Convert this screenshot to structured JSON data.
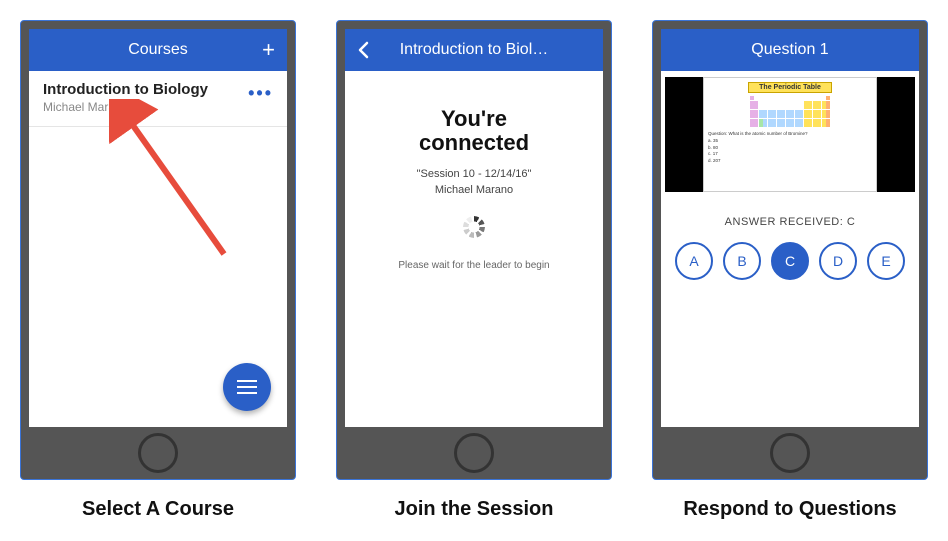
{
  "captions": {
    "c1": "Select A Course",
    "c2": "Join the Session",
    "c3": "Respond to Questions"
  },
  "screen1": {
    "header_title": "Courses",
    "course": {
      "title": "Introduction to Biology",
      "instructor": "Michael Marano"
    }
  },
  "screen2": {
    "header_title": "Introduction to Biol…",
    "headline": "You're\nconnected",
    "session_name": "\"Session 10 - 12/14/16\"",
    "presenter": "Michael Marano",
    "wait_text": "Please wait for the leader to begin"
  },
  "screen3": {
    "header_title": "Question 1",
    "slide_title": "The Periodic Table",
    "question_text": "Question: What is the atomic number of Bromine?",
    "question_opts": [
      "a. 35",
      "b. 80",
      "c. 17",
      "d. 207"
    ],
    "answer_label_prefix": "ANSWER RECEIVED: ",
    "answer_received": "C",
    "choices": [
      "A",
      "B",
      "C",
      "D",
      "E"
    ],
    "selected": "C"
  }
}
